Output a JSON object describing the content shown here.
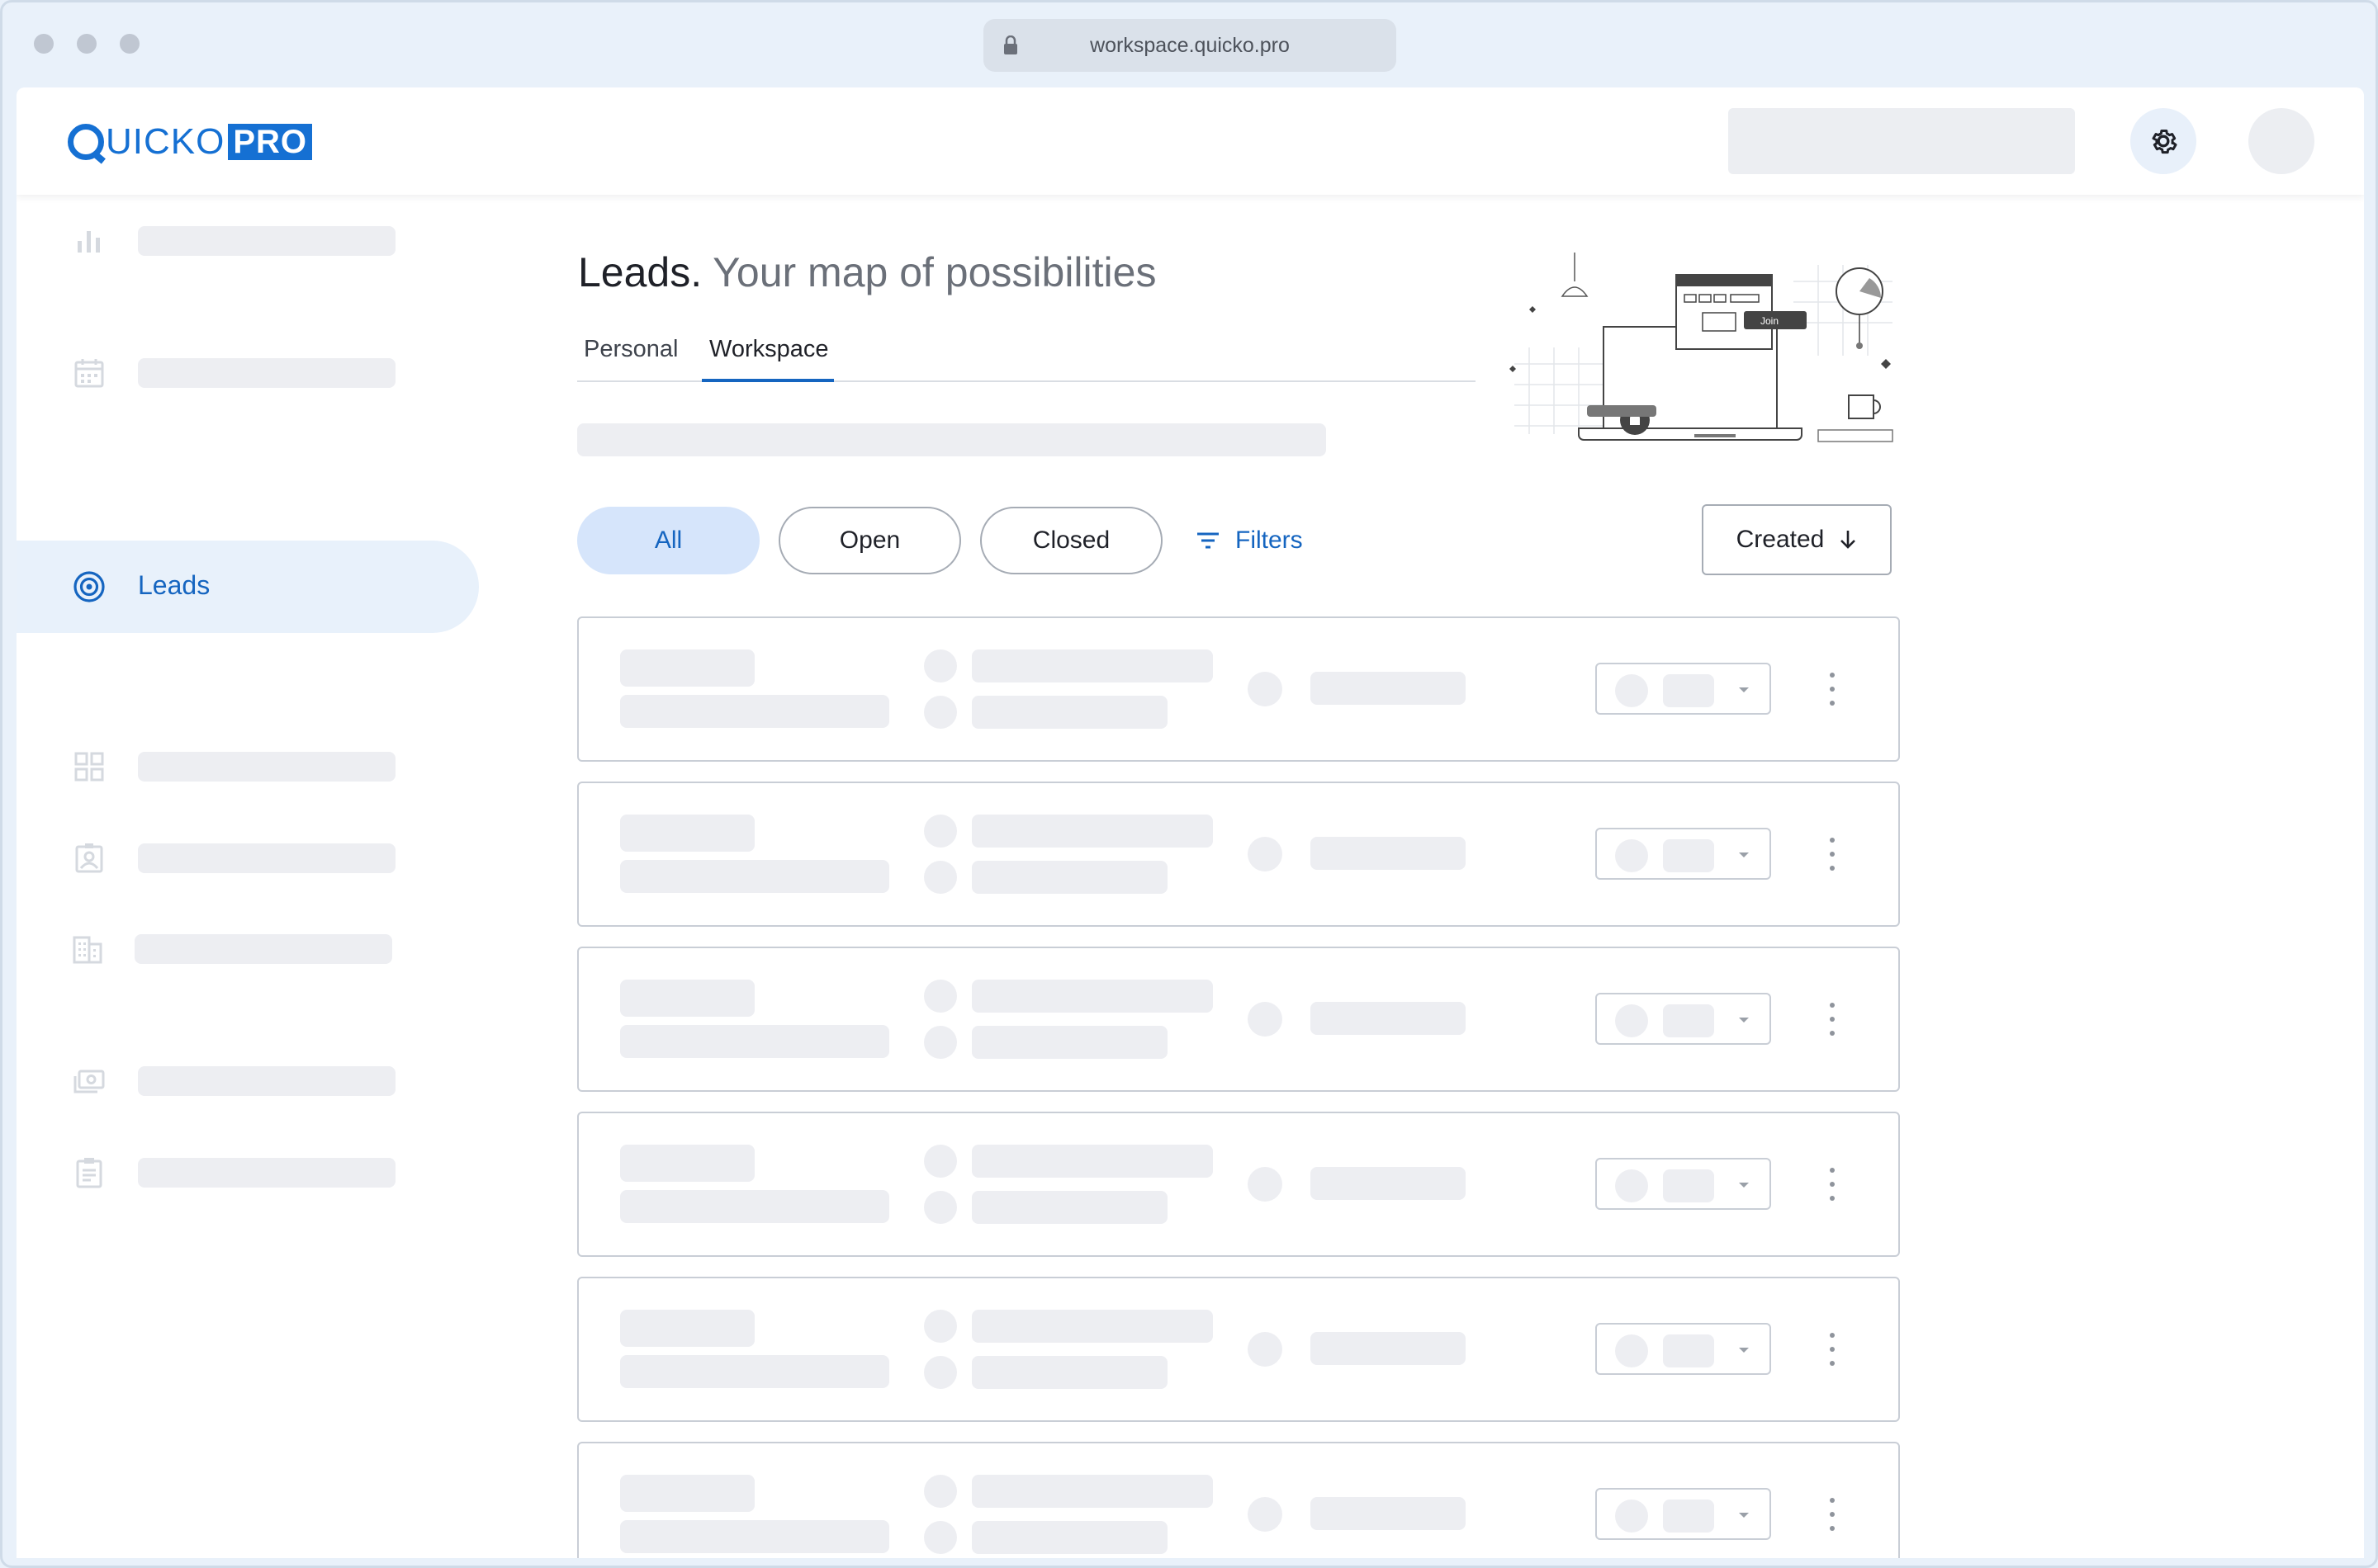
{
  "browser": {
    "url": "workspace.quicko.pro"
  },
  "brand": {
    "logo_text": "UICKO",
    "logo_pro": "PRO",
    "accent_color": "#1570d3"
  },
  "topbar": {
    "settings_icon": "gear-icon"
  },
  "sidebar": {
    "items": [
      {
        "icon": "bar-chart-icon",
        "label": "",
        "active": false
      },
      {
        "icon": "calendar-icon",
        "label": "",
        "active": false
      },
      {
        "icon": "target-icon",
        "label": "Leads",
        "active": true
      },
      {
        "icon": "grid-icon",
        "label": "",
        "active": false
      },
      {
        "icon": "contact-icon",
        "label": "",
        "active": false
      },
      {
        "icon": "building-icon",
        "label": "",
        "active": false
      },
      {
        "icon": "money-icon",
        "label": "",
        "active": false
      },
      {
        "icon": "clipboard-icon",
        "label": "",
        "active": false
      }
    ]
  },
  "page": {
    "title": "Leads.",
    "subtitle": "Your map of possibilities"
  },
  "tabs": [
    {
      "label": "Personal",
      "active": false
    },
    {
      "label": "Workspace",
      "active": true
    }
  ],
  "filters": {
    "chips": [
      {
        "label": "All",
        "active": true
      },
      {
        "label": "Open",
        "active": false
      },
      {
        "label": "Closed",
        "active": false
      }
    ],
    "filters_label": "Filters",
    "sort_label": "Created"
  },
  "illustration": {
    "join_label": "Join"
  },
  "leads": {
    "row_count": 6,
    "state": "loading"
  }
}
